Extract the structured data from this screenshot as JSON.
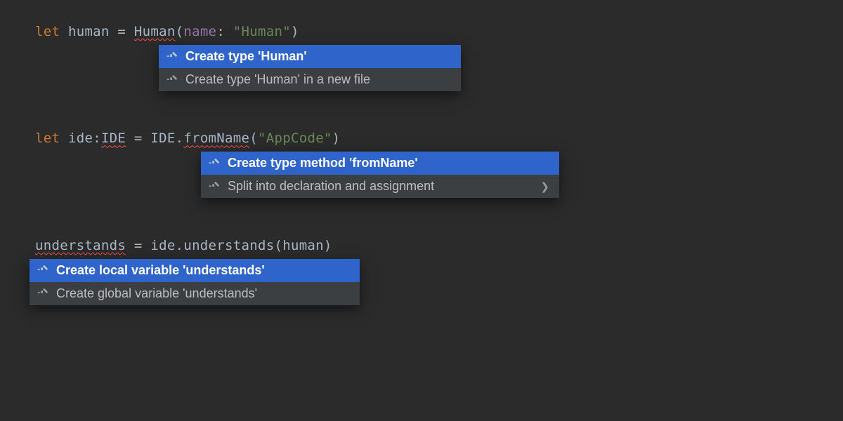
{
  "colors": {
    "bg": "#2b2b2b",
    "popup_bg": "#3c3f41",
    "selected": "#2f65ca",
    "keyword": "#cc7832",
    "string": "#6a8759"
  },
  "block1": {
    "code": {
      "kw": "let",
      "var": "human",
      "eq": " = ",
      "type": "Human",
      "paren_open": "(",
      "param": "name",
      "colon": ": ",
      "string": "\"Human\"",
      "paren_close": ")"
    },
    "popup": {
      "item0": "Create type 'Human'",
      "item1": "Create type 'Human' in a new file"
    }
  },
  "block2": {
    "code": {
      "kw": "let",
      "var": "ide",
      "colon1": ":",
      "type1": "IDE",
      "eq": " = ",
      "type2": "IDE",
      "dot": ".",
      "method": "fromName",
      "paren_open": "(",
      "string": "\"AppCode\"",
      "paren_close": ")"
    },
    "popup": {
      "item0": "Create type method 'fromName'",
      "item1": "Split into declaration and assignment"
    }
  },
  "block3": {
    "code": {
      "var": "understands",
      "eq": " = ",
      "obj": "ide",
      "dot": ".",
      "method": "understands",
      "paren_open": "(",
      "arg": "human",
      "paren_close": ")"
    },
    "popup": {
      "item0": "Create local variable 'understands'",
      "item1": "Create global variable 'understands'"
    }
  }
}
